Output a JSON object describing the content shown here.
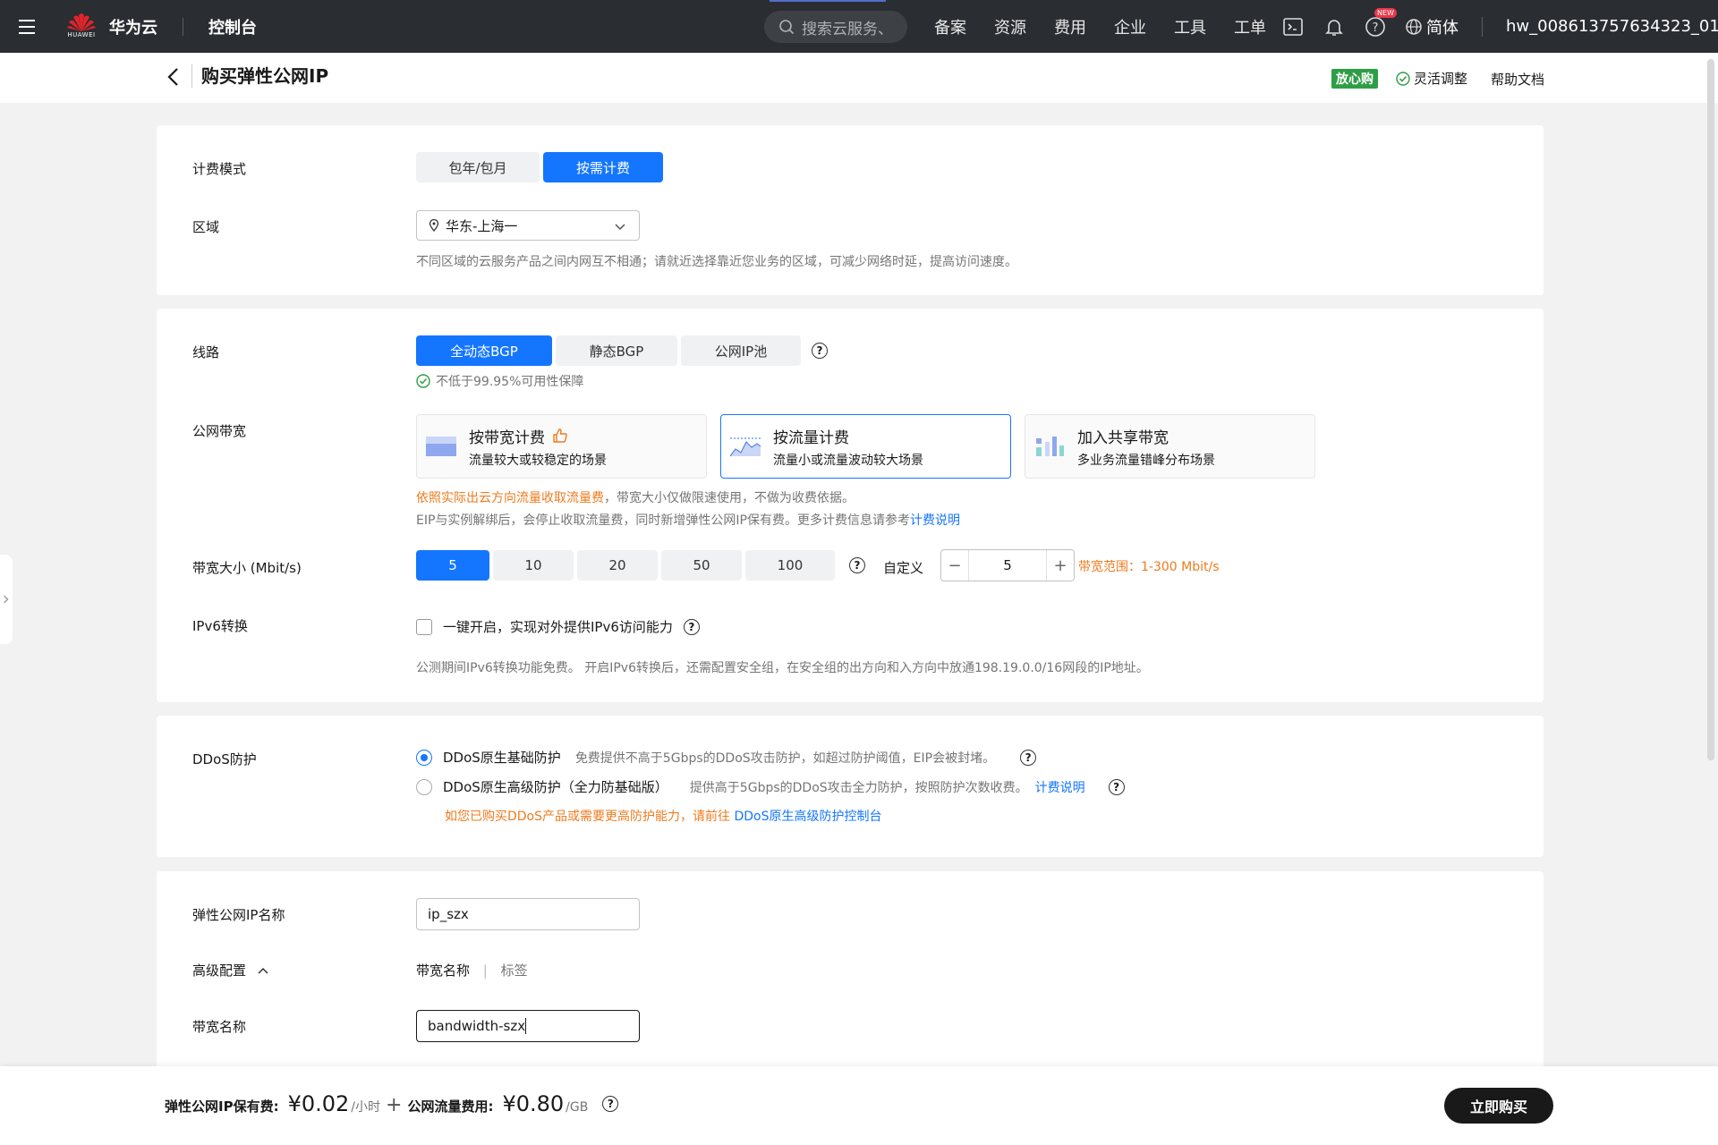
{
  "nav": {
    "brand": "华为云",
    "brand_sub": "HUAWEI",
    "console": "控制台",
    "search_placeholder": "搜索云服务、",
    "links": [
      "备案",
      "资源",
      "费用",
      "企业",
      "工具",
      "工单"
    ],
    "new_badge": "NEW",
    "lang": "简体",
    "user": "hw_008613757634323_01"
  },
  "header": {
    "title": "购买弹性公网IP",
    "badge": "放心购",
    "flex": "灵活调整",
    "help": "帮助文档"
  },
  "billing": {
    "label": "计费模式",
    "options": [
      "包年/包月",
      "按需计费"
    ],
    "selected": 1
  },
  "region": {
    "label": "区域",
    "value": "华东-上海一",
    "hint": "不同区域的云服务产品之间内网互不相通；请就近选择靠近您业务的区域，可减少网络时延，提高访问速度。"
  },
  "line": {
    "label": "线路",
    "options": [
      "全动态BGP",
      "静态BGP",
      "公网IP池"
    ],
    "selected": 0,
    "guarantee": "不低于99.95%可用性保障"
  },
  "bandwidth_type": {
    "label": "公网带宽",
    "cards": [
      {
        "title": "按带宽计费",
        "desc": "流量较大或较稳定的场景"
      },
      {
        "title": "按流量计费",
        "desc": "流量小或流量波动较大场景"
      },
      {
        "title": "加入共享带宽",
        "desc": "多业务流量错峰分布场景"
      }
    ],
    "selected": 1,
    "note1_orange": "依照实际出云方向流量收取流量费",
    "note1_rest": "，带宽大小仅做限速使用，不做为收费依据。",
    "note2": "EIP与实例解绑后，会停止收取流量费，同时新增弹性公网IP保有费。更多计费信息请参考",
    "note2_link": "计费说明"
  },
  "bandwidth_size": {
    "label": "带宽大小 (Mbit/s)",
    "options": [
      "5",
      "10",
      "20",
      "50",
      "100"
    ],
    "selected": 0,
    "custom_label": "自定义",
    "custom_value": "5",
    "range": "带宽范围：1-300 Mbit/s"
  },
  "ipv6": {
    "label": "IPv6转换",
    "checkbox_label": "一键开启，实现对外提供IPv6访问能力",
    "hint": "公测期间IPv6转换功能免费。 开启IPv6转换后，还需配置安全组，在安全组的出方向和入方向中放通198.19.0.0/16网段的IP地址。"
  },
  "ddos": {
    "label": "DDoS防护",
    "opt1_title": "DDoS原生基础防护",
    "opt1_desc": "免费提供不高于5Gbps的DDoS攻击防护，如超过防护阈值，EIP会被封堵。",
    "opt2_title": "DDoS原生高级防护（全力防基础版）",
    "opt2_desc": "提供高于5Gbps的DDoS攻击全力防护，按照防护次数收费。",
    "opt2_link": "计费说明",
    "note": "如您已购买DDoS产品或需要更高防护能力，请前往",
    "note_link": "DDoS原生高级防护控制台"
  },
  "eip_name": {
    "label": "弹性公网IP名称",
    "value": "ip_szx"
  },
  "advanced": {
    "label": "高级配置",
    "tab1": "带宽名称",
    "divider": "|",
    "tab2": "标签"
  },
  "bw_name": {
    "label": "带宽名称",
    "value": "bandwidth-szx"
  },
  "footer": {
    "fee1_label": "弹性公网IP保有费:",
    "fee1_amount": "¥0.02",
    "fee1_unit": "/小时",
    "plus": "+",
    "fee2_label": "公网流量费用:",
    "fee2_amount": "¥0.80",
    "fee2_unit": "/GB",
    "buy": "立即购买"
  }
}
